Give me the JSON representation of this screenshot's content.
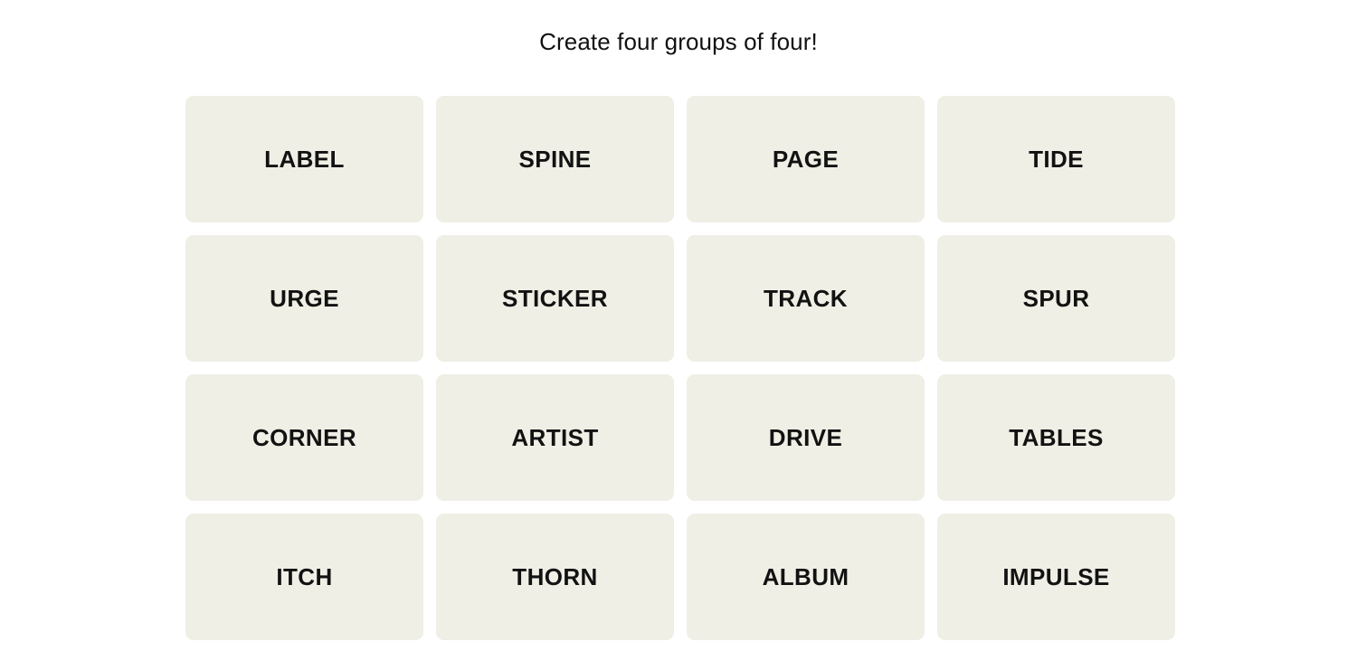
{
  "board": {
    "title": "Create four groups of four!",
    "background_color": "#ffffff",
    "tile_color": "#efefe6",
    "tile_text_color": "#121212",
    "columns": 4,
    "rows": 4,
    "tiles": [
      {
        "label": "LABEL"
      },
      {
        "label": "SPINE"
      },
      {
        "label": "PAGE"
      },
      {
        "label": "TIDE"
      },
      {
        "label": "URGE"
      },
      {
        "label": "STICKER"
      },
      {
        "label": "TRACK"
      },
      {
        "label": "SPUR"
      },
      {
        "label": "CORNER"
      },
      {
        "label": "ARTIST"
      },
      {
        "label": "DRIVE"
      },
      {
        "label": "TABLES"
      },
      {
        "label": "ITCH"
      },
      {
        "label": "THORN"
      },
      {
        "label": "ALBUM"
      },
      {
        "label": "IMPULSE"
      }
    ]
  }
}
